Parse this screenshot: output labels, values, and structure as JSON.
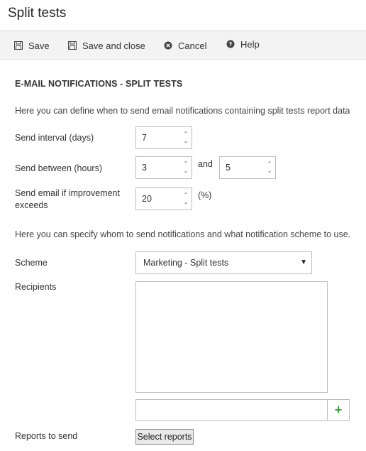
{
  "page": {
    "title": "Split tests"
  },
  "toolbar": {
    "save": "Save",
    "save_close": "Save and close",
    "cancel": "Cancel",
    "help": "Help"
  },
  "section": {
    "title": "E-MAIL NOTIFICATIONS - SPLIT TESTS"
  },
  "info": {
    "define": "Here you can define when to send email notifications containing split tests report data",
    "specify": "Here you can specify whom to send notifications and what notification scheme to use."
  },
  "form": {
    "interval_label": "Send interval (days)",
    "interval_value": "7",
    "between_label": "Send between (hours)",
    "between_from": "3",
    "between_and": "and",
    "between_to": "5",
    "improvement_label_line1": "Send email if improvement",
    "improvement_label_line2": "exceeds",
    "improvement_value": "20",
    "improvement_unit": "(%)",
    "scheme_label": "Scheme",
    "scheme_value": "Marketing - Split tests",
    "recipients_label": "Recipients",
    "add_symbol": "+",
    "reports_label": "Reports to send",
    "select_reports": "Select reports"
  },
  "icons": {
    "save": "floppy-disk-icon",
    "save_close": "floppy-disk-icon",
    "cancel": "x-circle-icon",
    "help": "question-circle-icon",
    "add": "plus-icon"
  },
  "colors": {
    "add_plus": "#3aa43a"
  }
}
